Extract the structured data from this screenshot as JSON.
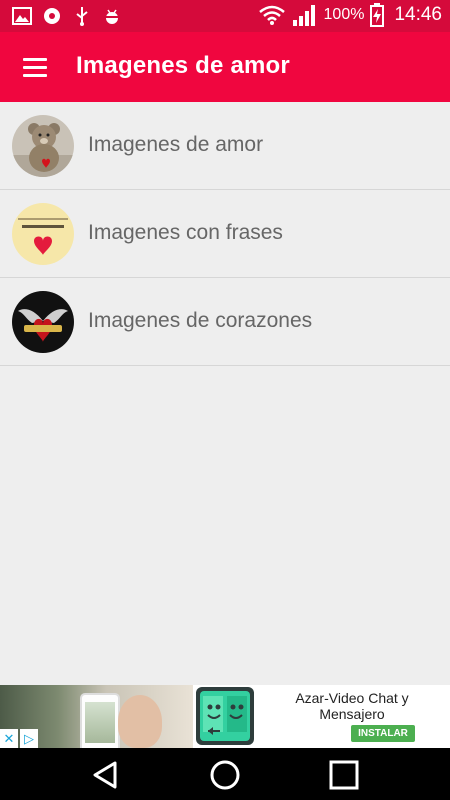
{
  "status_bar": {
    "battery_percent": "100%",
    "time": "14:46",
    "icons": [
      "gallery-icon",
      "sync-icon",
      "usb-icon",
      "android-debug-icon",
      "wifi-icon",
      "signal-icon",
      "battery-charging-icon"
    ],
    "background_color": "#d50a3b"
  },
  "app_bar": {
    "title": "Imagenes de amor",
    "background_color": "#f0063f",
    "menu_icon": "hamburger-menu-icon"
  },
  "list": {
    "items": [
      {
        "label": "Imagenes de amor",
        "thumbnail": "teddy-bear-heart-image"
      },
      {
        "label": "Imagenes con frases",
        "thumbnail": "quote-heart-image"
      },
      {
        "label": "Imagenes de corazones",
        "thumbnail": "winged-heart-image"
      }
    ]
  },
  "ad": {
    "app_name": "Azar-Video Chat y Mensajero",
    "install_label": "INSTALAR",
    "install_color": "#4caf50",
    "icon": "azar-app-icon"
  },
  "nav_bar": {
    "buttons": [
      "back-icon",
      "home-icon",
      "recents-icon"
    ]
  }
}
